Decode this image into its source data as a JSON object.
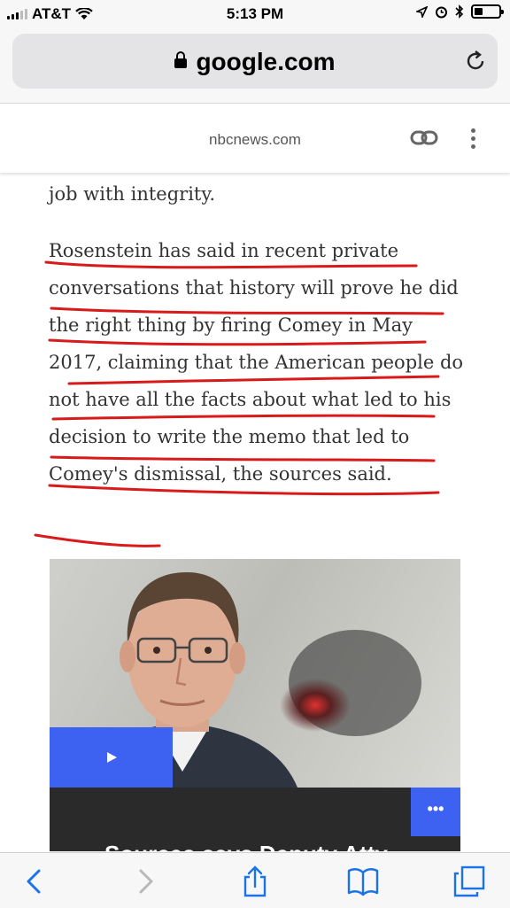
{
  "status_bar": {
    "carrier": "AT&T",
    "time": "5:13 PM"
  },
  "browser": {
    "url": "google.com",
    "amp_domain": "nbcnews.com"
  },
  "article": {
    "paragraph_1": "job with integrity.",
    "paragraph_2": "Rosenstein has said in recent private conversations that history will prove he did the right thing by firing Comey in May 2017, claiming that the American people do not have all the facts about what led to his decision to write the memo that led to Comey's dismissal, the sources said."
  },
  "video_card": {
    "play_icon": "play-icon",
    "more_label": "•••",
    "headline": "Sources says Deputy Atty"
  },
  "colors": {
    "accent_blue": "#3d62f2",
    "annotation_red": "#d91a1a",
    "ios_blue": "#1a73e8"
  },
  "toolbar": {
    "icons": [
      "back-icon",
      "forward-icon",
      "share-icon",
      "bookmarks-icon",
      "tabs-icon"
    ]
  }
}
